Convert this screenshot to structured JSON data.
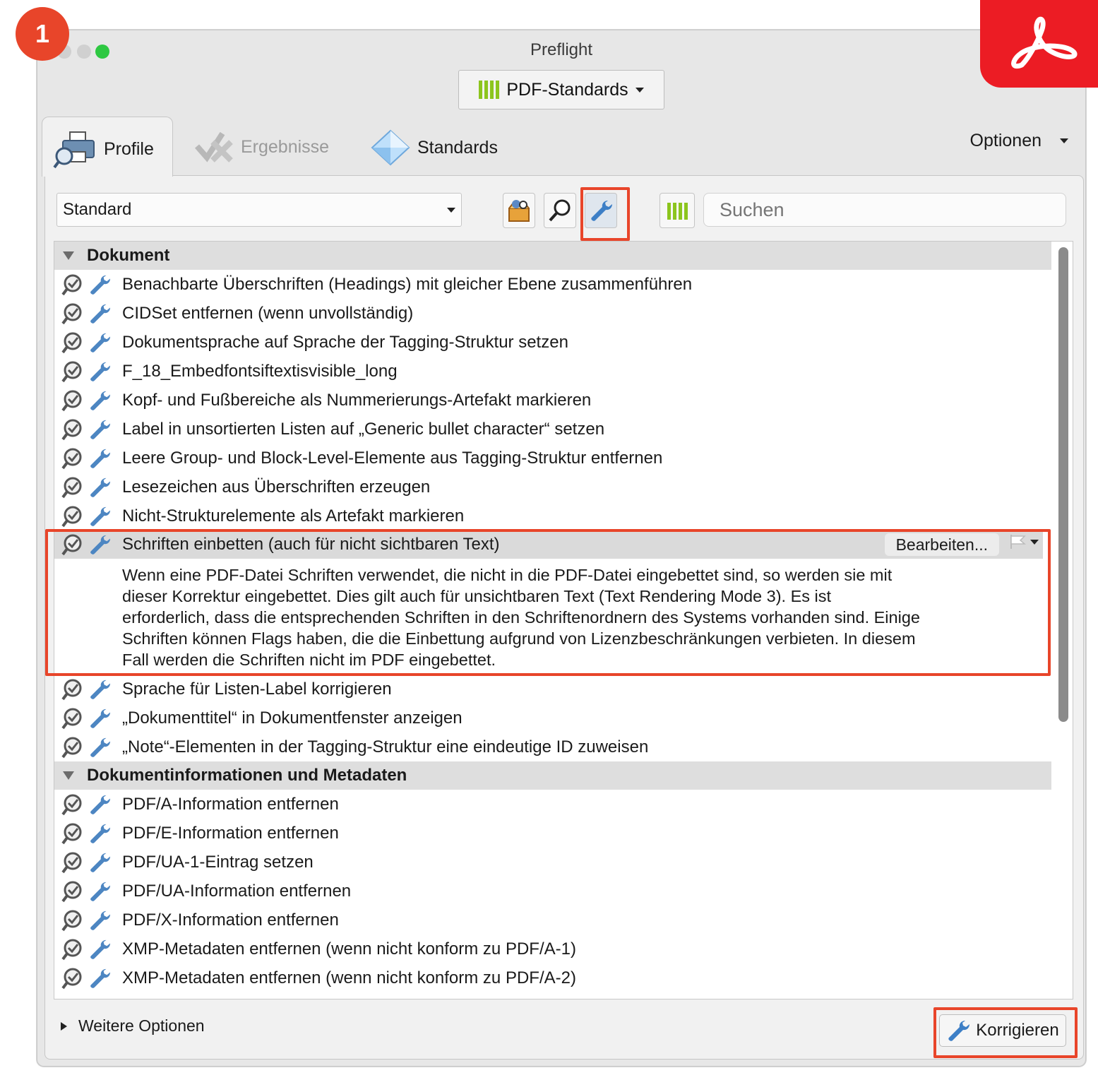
{
  "step_badge": "1",
  "window": {
    "title": "Preflight"
  },
  "standards_select": {
    "label": "PDF-Standards"
  },
  "tabs": [
    {
      "label": "Profile"
    },
    {
      "label": "Ergebnisse"
    },
    {
      "label": "Standards"
    }
  ],
  "options": {
    "label": "Optionen"
  },
  "profile_select": {
    "value": "Standard"
  },
  "search": {
    "placeholder": "Suchen"
  },
  "groups": [
    {
      "title": "Dokument",
      "items": [
        "Benachbarte Überschriften (Headings) mit gleicher Ebene zusammenführen",
        "CIDSet entfernen (wenn unvollständig)",
        "Dokumentsprache auf Sprache der Tagging-Struktur setzen",
        "F_18_Embedfontsiftextisvisible_long",
        "Kopf- und Fußbereiche als Nummerierungs-Artefakt markieren",
        "Label in unsortierten Listen auf „Generic bullet character“ setzen",
        "Leere Group- und Block-Level-Elemente aus Tagging-Struktur entfernen",
        "Lesezeichen aus Überschriften erzeugen",
        "Nicht-Strukturelemente als Artefakt markieren"
      ],
      "selected": {
        "label": "Schriften einbetten (auch für nicht sichtbaren Text)",
        "edit_label": "Bearbeiten...",
        "description": [
          "Wenn eine PDF-Datei Schriften verwendet, die nicht in die PDF-Datei eingebettet sind, so werden sie mit",
          "dieser Korrektur eingebettet. Dies gilt auch für unsichtbaren Text (Text Rendering Mode 3). Es ist",
          "erforderlich, dass die entsprechenden Schriften in den Schriftenordnern des Systems vorhanden sind. Einige",
          "Schriften können Flags haben, die die Einbettung aufgrund von Lizenzbeschränkungen verbieten. In diesem",
          "Fall werden die Schriften nicht im PDF eingebettet."
        ]
      },
      "items_after": [
        "Sprache für Listen-Label korrigieren",
        "„Dokumenttitel“ in Dokumentfenster anzeigen",
        "„Note“-Elementen in der Tagging-Struktur eine eindeutige ID zuweisen"
      ]
    },
    {
      "title": "Dokumentinformationen und Metadaten",
      "items": [
        "PDF/A-Information entfernen",
        "PDF/E-Information entfernen",
        "PDF/UA-1-Eintrag setzen",
        "PDF/UA-Information entfernen",
        "PDF/X-Information entfernen",
        "XMP-Metadaten entfernen (wenn nicht konform zu PDF/A-1)",
        "XMP-Metadaten entfernen (wenn nicht konform zu PDF/A-2)"
      ]
    }
  ],
  "more_options": {
    "label": "Weitere Optionen"
  },
  "fix_button": {
    "label": "Korrigieren"
  },
  "colors": {
    "highlight": "#e8452a",
    "accent_green": "#8cc51e",
    "logo_red": "#ec1c24"
  }
}
